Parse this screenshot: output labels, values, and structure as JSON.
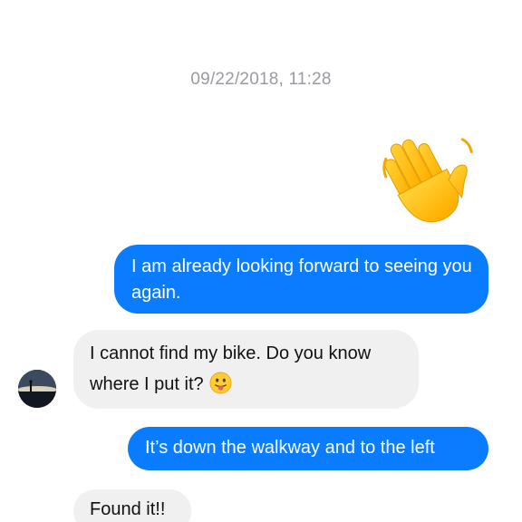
{
  "conversation": {
    "timestamp": "09/22/2018, 11:28",
    "sticker": {
      "icon": "waving-hand-icon"
    },
    "messages": [
      {
        "direction": "outgoing",
        "text": "I am already looking forward to seeing you again."
      },
      {
        "direction": "incoming",
        "text": "I cannot find my bike. Do you know where I put it?",
        "emoji": "face-with-tongue-icon"
      },
      {
        "direction": "outgoing",
        "text": "It’s down the walkway and to the left"
      },
      {
        "direction": "incoming",
        "text": "Found it!!"
      }
    ]
  },
  "colors": {
    "outgoing_bubble": "#0a7cff",
    "incoming_bubble": "#f0f0f0",
    "timestamp_text": "#9a9a9f"
  }
}
